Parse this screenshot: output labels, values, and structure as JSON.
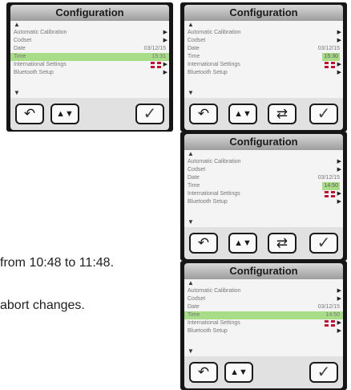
{
  "screens": [
    {
      "title": "Configuration",
      "rows": [
        {
          "label": "Automatic Calibration",
          "value": "",
          "chevron": true
        },
        {
          "label": "Codset",
          "value": "",
          "chevron": true
        },
        {
          "label": "Date",
          "value": "03/12/15",
          "chevron": false
        },
        {
          "label": "Time",
          "value": "15:31",
          "chevron": false,
          "highlighted": true
        },
        {
          "label": "International Settings",
          "value": "",
          "chevron": true,
          "flag": true
        },
        {
          "label": "Bluetooth Setup",
          "value": "",
          "chevron": true
        }
      ],
      "buttons": [
        "back",
        "updown",
        "check"
      ]
    },
    {
      "title": "Configuration",
      "rows": [
        {
          "label": "Automatic Calibration",
          "value": "",
          "chevron": true
        },
        {
          "label": "Codset",
          "value": "",
          "chevron": true
        },
        {
          "label": "Date",
          "value": "03/12/15",
          "chevron": false
        },
        {
          "label": "Time",
          "value": "15:30",
          "chevron": false,
          "highlighted": true
        },
        {
          "label": "International Settings",
          "value": "",
          "chevron": true,
          "flag": true
        },
        {
          "label": "Bluetooth Setup",
          "value": "",
          "chevron": true
        }
      ],
      "buttons": [
        "back",
        "updown",
        "cycle",
        "check"
      ]
    },
    {
      "title": "Configuration",
      "rows": [
        {
          "label": "Automatic Calibration",
          "value": "",
          "chevron": true
        },
        {
          "label": "Codset",
          "value": "",
          "chevron": true
        },
        {
          "label": "Date",
          "value": "03/12/15",
          "chevron": false
        },
        {
          "label": "Time",
          "value": "14:50",
          "chevron": false,
          "highlighted": true
        },
        {
          "label": "International Settings",
          "value": "",
          "chevron": true,
          "flag": true
        },
        {
          "label": "Bluetooth Setup",
          "value": "",
          "chevron": true
        }
      ],
      "buttons": [
        "back",
        "updown",
        "cycle",
        "check"
      ]
    },
    {
      "title": "Configuration",
      "rows": [
        {
          "label": "Automatic Calibration",
          "value": "",
          "chevron": true
        },
        {
          "label": "Codset",
          "value": "",
          "chevron": true
        },
        {
          "label": "Date",
          "value": "03/12/15",
          "chevron": false
        },
        {
          "label": "Time",
          "value": "14:50",
          "chevron": false,
          "highlighted": true
        },
        {
          "label": "International Settings",
          "value": "",
          "chevron": true,
          "flag": true
        },
        {
          "label": "Bluetooth Setup",
          "value": "",
          "chevron": true
        }
      ],
      "buttons": [
        "back",
        "updown",
        "check"
      ]
    }
  ],
  "captions": {
    "line1": "from 10:48 to 11:48.",
    "line2": "abort changes."
  },
  "icons": {
    "back": "↶",
    "updown": "▲▼",
    "cycle": "⇄",
    "check": "✓",
    "up_arrow": "▲",
    "down_arrow": "▼",
    "chevron": "▶"
  },
  "colors": {
    "highlight": "#a9dc87",
    "screen_bg": "#161616",
    "title_bar": "#b8b8b8"
  }
}
